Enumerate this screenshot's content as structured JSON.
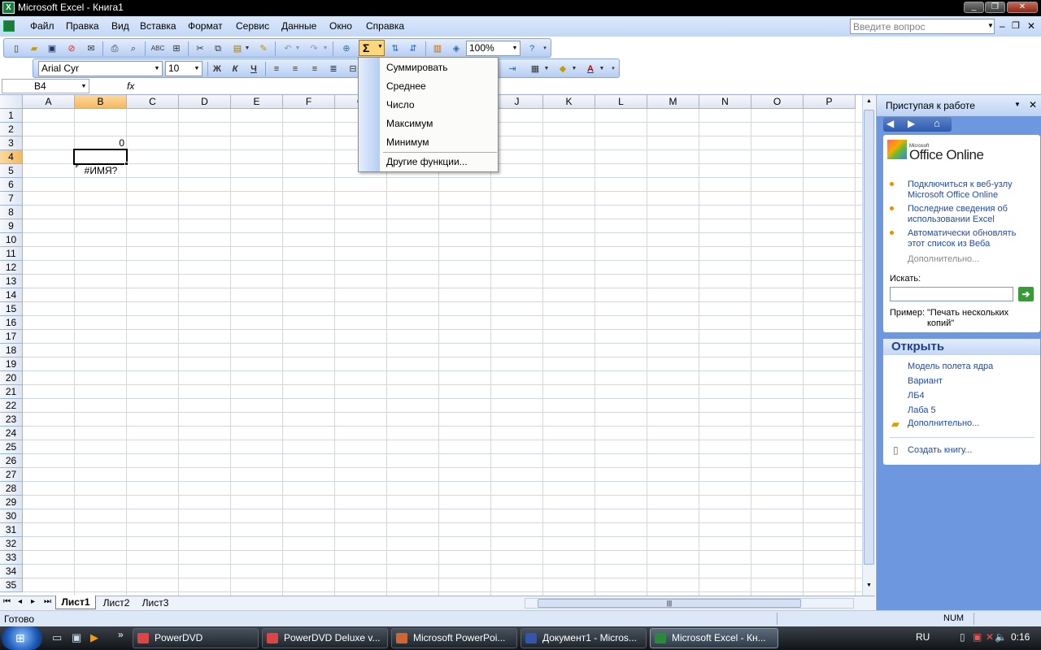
{
  "window": {
    "title": "Microsoft Excel - Книга1",
    "app_icon": "excel-icon"
  },
  "menu": {
    "items": [
      "Файл",
      "Правка",
      "Вид",
      "Вставка",
      "Формат",
      "Сервис",
      "Данные",
      "Окно",
      "Справка"
    ],
    "help_placeholder": "Введите вопрос"
  },
  "toolbar": {
    "zoom": "100%",
    "sigma": "Σ"
  },
  "format_toolbar": {
    "font": "Arial Cyr",
    "size": "10",
    "bold": "Ж",
    "italic": "К",
    "underline": "Ч",
    "font_color_letter": "A"
  },
  "formula_bar": {
    "name_box": "B4",
    "fx": "fx",
    "content": ""
  },
  "grid": {
    "columns": [
      "A",
      "B",
      "C",
      "D",
      "E",
      "F",
      "G",
      "H",
      "I",
      "J",
      "K",
      "L",
      "M",
      "N",
      "O",
      "P"
    ],
    "rows": [
      "1",
      "2",
      "3",
      "4",
      "5",
      "6",
      "7",
      "8",
      "9",
      "10",
      "11",
      "12",
      "13",
      "14",
      "15",
      "16",
      "17",
      "18",
      "19",
      "20",
      "21",
      "22",
      "23",
      "24",
      "25",
      "26",
      "27",
      "28",
      "29",
      "30",
      "31",
      "32",
      "33",
      "34",
      "35"
    ],
    "cells": {
      "B3": "0",
      "B5": "#ИМЯ?"
    },
    "active_cell": "B4"
  },
  "autosum_menu": {
    "items": [
      "Суммировать",
      "Среднее",
      "Число",
      "Максимум",
      "Минимум"
    ],
    "more": "Другие функции..."
  },
  "sheet_tabs": [
    "Лист1",
    "Лист2",
    "Лист3"
  ],
  "status": {
    "text": "Готово",
    "num": "NUM"
  },
  "task_pane": {
    "title": "Приступая к работе",
    "logo_small": "Microsoft",
    "logo": "Office Online",
    "links": [
      "Подключиться к веб-узлу Microsoft Office Online",
      "Последние сведения об использовании Excel",
      "Автоматически обновлять этот список из Веба"
    ],
    "more": "Дополнительно...",
    "search_label": "Искать:",
    "example_label": "Пример:",
    "example_text": "\"Печать нескольких копий\"",
    "open_title": "Открыть",
    "recent_files": [
      "Модель полета ядра",
      "Вариант",
      "ЛБ4",
      "Лаба 5"
    ],
    "open_more": "Дополнительно...",
    "create": "Создать книгу..."
  },
  "taskbar": {
    "tasks": [
      "PowerDVD",
      "PowerDVD Deluxe v...",
      "Microsoft PowerPoi...",
      "Документ1 - Micros...",
      "Microsoft Excel - Кн..."
    ],
    "lang": "RU",
    "time": "0:16"
  }
}
